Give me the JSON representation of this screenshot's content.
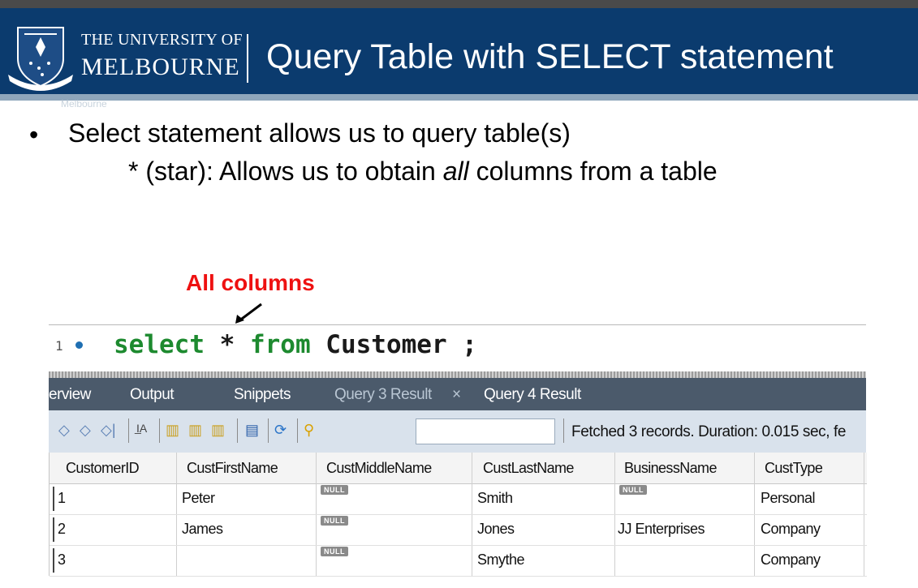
{
  "header": {
    "university_line1": "THE UNIVERSITY OF",
    "university_line2": "MELBOURNE",
    "title": "Query Table with SELECT statement",
    "crest_icon": "university-crest-icon"
  },
  "body": {
    "ghost_text": "Melbourne",
    "bullet_symbol": "•",
    "bullet1": "Select statement allows us to query table(s)",
    "sub_prefix": "* (star): Allows us to obtain ",
    "sub_italic": "all",
    "sub_suffix": " columns from a table"
  },
  "annotation": {
    "label": "All columns",
    "color": "#ee1111"
  },
  "editor": {
    "line_number": "1",
    "kw_select": "select",
    "star": " * ",
    "kw_from": "from",
    "rest": " Customer ;"
  },
  "tabs": [
    {
      "label": "erview"
    },
    {
      "label": "Output"
    },
    {
      "label": "Snippets"
    },
    {
      "label": "Query 3 Result"
    },
    {
      "label": "Query 4 Result"
    }
  ],
  "tab_close": "×",
  "toolbar": {
    "status": "Fetched 3 records. Duration: 0.015 sec, fe"
  },
  "grid": {
    "columns": [
      "CustomerID",
      "CustFirstName",
      "CustMiddleName",
      "CustLastName",
      "BusinessName",
      "CustType"
    ],
    "null_label": "NULL",
    "rows": [
      {
        "id": "1",
        "first": "Peter",
        "last": "Smith",
        "business": "",
        "type": "Personal"
      },
      {
        "id": "2",
        "first": "James",
        "last": "Jones",
        "business": "JJ Enterprises",
        "type": "Company"
      },
      {
        "id": "3",
        "first": "",
        "last": "Smythe",
        "business": "",
        "type": "Company"
      }
    ]
  },
  "colors": {
    "header_bg": "#0b3b6e",
    "keyword": "#1d8a2f",
    "tabbar": "#4b5a6b",
    "toolbar": "#d9e2ec"
  }
}
